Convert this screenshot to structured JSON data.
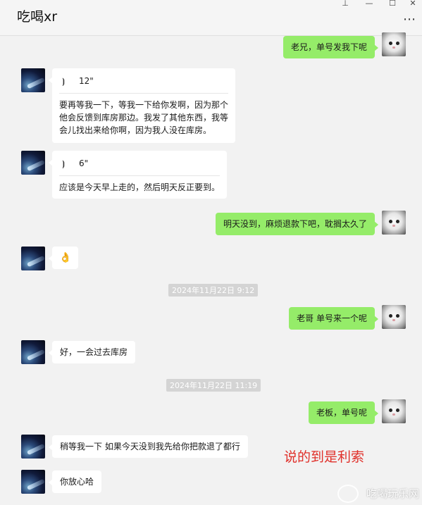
{
  "window": {
    "title": "吃喝xr",
    "pin_glyph": "⊥",
    "minimize_glyph": "—",
    "maximize_glyph": "☐",
    "close_glyph": "✕",
    "more_glyph": "⋯"
  },
  "messages": [
    {
      "side": "right",
      "text": "老兄，单号发我下呢"
    },
    {
      "side": "left",
      "voice_duration": "12\"",
      "transcript": "要再等我一下，等我一下给你发啊，因为那个他会反馈到库房那边。我发了其他东西，我等会儿找出来给你啊，因为我人没在库房。"
    },
    {
      "side": "left",
      "voice_duration": "6\"",
      "transcript": "应该是今天早上走的，然后明天反正要到。"
    },
    {
      "side": "right",
      "text": "明天没到，麻烦退款下吧，耽搁太久了"
    },
    {
      "side": "left",
      "text": "👌"
    },
    {
      "timestamp": "2024年11月22日 9:12"
    },
    {
      "side": "right",
      "text": "老哥 单号来一个呢"
    },
    {
      "side": "left",
      "text": "好，一会过去库房"
    },
    {
      "timestamp": "2024年11月22日 11:19"
    },
    {
      "side": "right",
      "text": "老板，单号呢"
    },
    {
      "side": "left",
      "text": "稍等我一下 如果今天没到我先给你把款退了都行"
    },
    {
      "side": "left",
      "text": "你放心哈"
    }
  ],
  "transcript_lines": {
    "m1": [
      "要再等我一下，等我一下给你发啊，因为那个",
      "他会反馈到库房那边。我发了其他东西，我等",
      "会儿找出来给你啊，因为我人没在库房。"
    ]
  },
  "annotation": "说的到是利索",
  "watermark": "吃喝玩乐网",
  "colors": {
    "outgoing_bubble": "#95ec69",
    "incoming_bubble": "#ffffff",
    "background": "#f2f2f2",
    "annotation": "#e0302a"
  }
}
